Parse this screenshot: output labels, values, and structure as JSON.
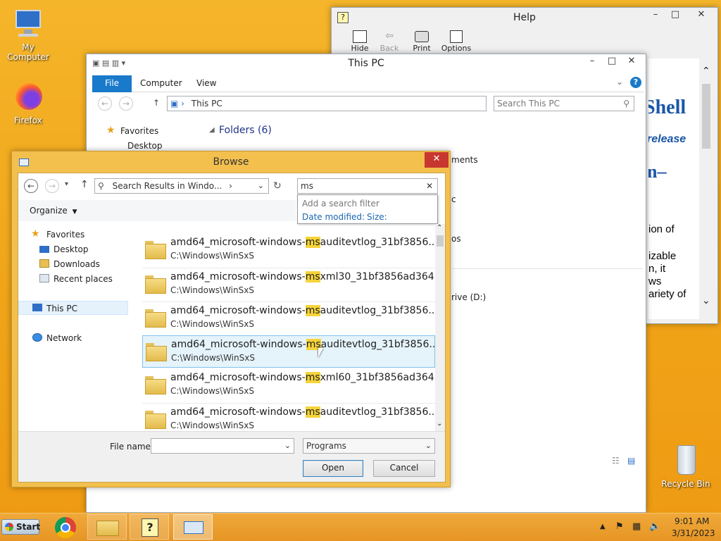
{
  "desktop": {
    "my_computer": "My Computer",
    "firefox": "Firefox",
    "recycle_bin": "Recycle Bin"
  },
  "help_window": {
    "title": "Help",
    "toolbar": [
      "Hide",
      "Back",
      "Print",
      "Options"
    ],
    "content": [
      "Shell",
      "release",
      "n–",
      "ion of",
      "izable",
      "n, it",
      "ws",
      "ariety of"
    ]
  },
  "explorer": {
    "title": "This PC",
    "ribbon_tabs": [
      "File",
      "Computer",
      "View"
    ],
    "address": "This PC",
    "search_placeholder": "Search This PC",
    "favorites": "Favorites",
    "desktop": "Desktop",
    "folders_header": "Folders (6)",
    "peek_items": [
      "ments",
      "c",
      "os",
      "rive (D:)"
    ]
  },
  "browse": {
    "title": "Browse",
    "address": "Search Results in Windo...",
    "search_value": "ms",
    "organize": "Organize",
    "filter": {
      "hint": "Add a search filter",
      "date_modified": "Date modified:",
      "size": "Size:"
    },
    "nav": {
      "favorites": "Favorites",
      "desktop": "Desktop",
      "downloads": "Downloads",
      "recent": "Recent places",
      "this_pc": "This PC",
      "network": "Network"
    },
    "files": [
      {
        "pre": "amd64_microsoft-windows-",
        "hl": "ms",
        "post": "auditevtlog_31bf3856...",
        "path": "C:\\Windows\\WinSxS"
      },
      {
        "pre": "amd64_microsoft-windows-",
        "hl": "ms",
        "post": "xml30_31bf3856ad364...",
        "path": "C:\\Windows\\WinSxS"
      },
      {
        "pre": "amd64_microsoft-windows-",
        "hl": "ms",
        "post": "auditevtlog_31bf3856...",
        "path": "C:\\Windows\\WinSxS"
      },
      {
        "pre": "amd64_microsoft-windows-",
        "hl": "ms",
        "post": "auditevtlog_31bf3856...",
        "path": "C:\\Windows\\WinSxS"
      },
      {
        "pre": "amd64_microsoft-windows-",
        "hl": "ms",
        "post": "xml60_31bf3856ad364...",
        "path": "C:\\Windows\\WinSxS"
      },
      {
        "pre": "amd64_microsoft-windows-",
        "hl": "ms",
        "post": "auditevtlog_31bf3856...",
        "path": "C:\\Windows\\WinSxS"
      }
    ],
    "file_name_label": "File name:",
    "file_name_value": "",
    "file_type": "Programs",
    "open": "Open",
    "cancel": "Cancel"
  },
  "taskbar": {
    "start": "Start",
    "time": "9:01 AM",
    "date": "3/31/2023"
  }
}
